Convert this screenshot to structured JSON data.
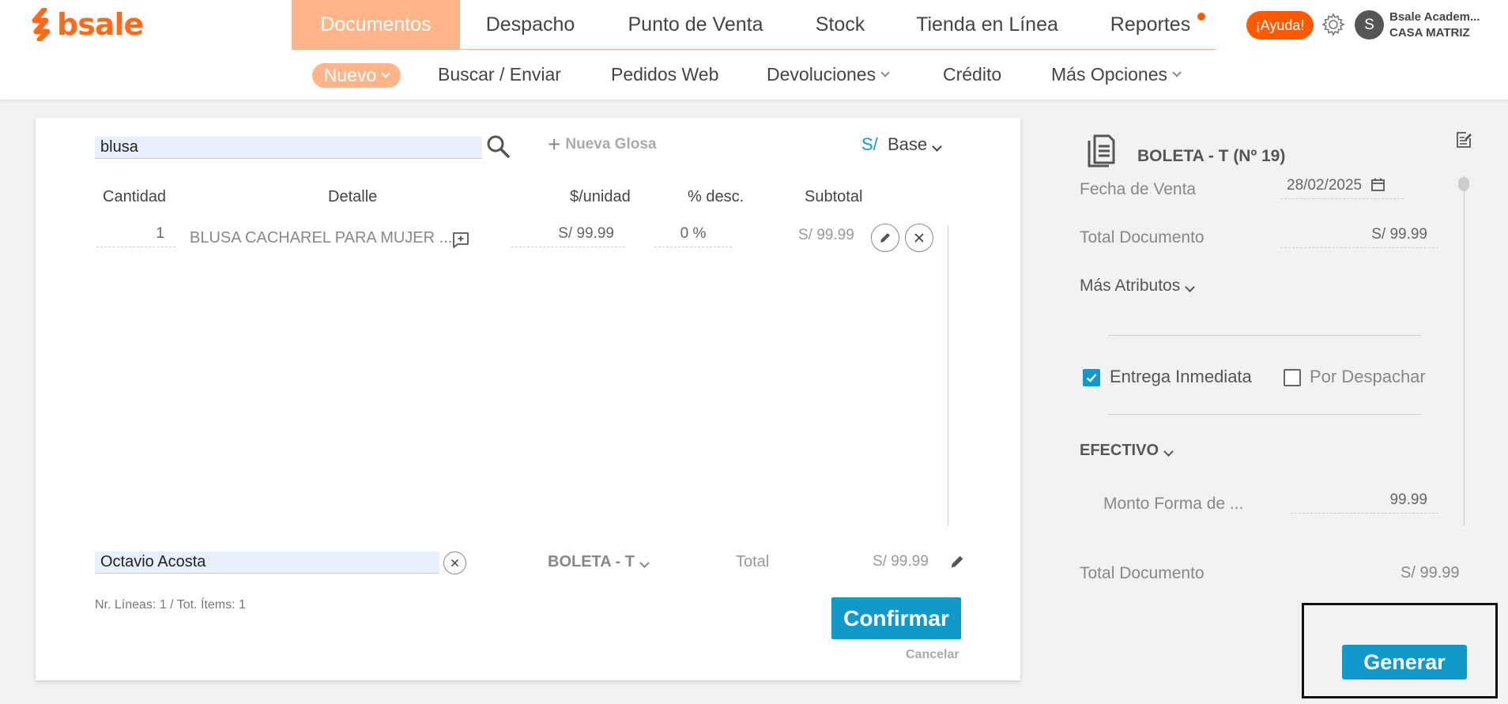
{
  "app": {
    "brand": "bsale"
  },
  "header": {
    "tabs": [
      {
        "label": "Documentos",
        "active": true
      },
      {
        "label": "Despacho"
      },
      {
        "label": "Punto de Venta"
      },
      {
        "label": "Stock"
      },
      {
        "label": "Tienda en Línea"
      },
      {
        "label": "Reportes",
        "has_notification": true
      }
    ],
    "help_label": "¡Ayuda!",
    "user_initial": "S",
    "user_name": "Bsale Academ...",
    "branch": "CASA MATRIZ"
  },
  "subnav": {
    "items": [
      {
        "label": "Nuevo",
        "active": true,
        "dropdown": true
      },
      {
        "label": "Buscar / Enviar"
      },
      {
        "label": "Pedidos Web"
      },
      {
        "label": "Devoluciones",
        "dropdown": true
      },
      {
        "label": "Crédito"
      },
      {
        "label": "Más Opciones",
        "dropdown": true
      }
    ]
  },
  "editor": {
    "search_value": "blusa",
    "new_gloss_label": "Nueva Glosa",
    "currency_symbol": "S/",
    "price_list": "Base",
    "columns": [
      "Cantidad",
      "Detalle",
      "$/unidad",
      "% desc.",
      "Subtotal"
    ],
    "lines": [
      {
        "quantity": "1",
        "detail": "BLUSA CACHAREL PARA MUJER ...",
        "unit_price": "S/ 99.99",
        "discount": "0 %",
        "subtotal": "S/ 99.99"
      }
    ],
    "client_value": "Octavio Acosta",
    "document_type": "BOLETA - T",
    "total_label": "Total",
    "total_value": "S/ 99.99",
    "lines_info": "Nr. Líneas: 1 / Tot. Ítems: 1",
    "confirm_label": "Confirmar",
    "cancel_label": "Cancelar"
  },
  "summary": {
    "document_title": "BOLETA - T (Nº 19)",
    "sale_date_label": "Fecha de Venta",
    "sale_date_value": "28/02/2025",
    "doc_total_label": "Total Documento",
    "doc_total_value": "S/ 99.99",
    "more_attributes_label": "Más Atributos",
    "immediate_delivery_label": "Entrega Inmediata",
    "immediate_delivery_checked": true,
    "to_dispatch_label": "Por Despachar",
    "to_dispatch_checked": false,
    "payment_method": "EFECTIVO",
    "payment_amount_label": "Monto Forma de ...",
    "payment_amount_value": "99.99",
    "footer_total_label": "Total Documento",
    "footer_total_value": "S/ 99.99",
    "generate_label": "Generar"
  },
  "colors": {
    "brand_orange": "#ff6b1a",
    "active_tab": "#ffb58a",
    "accent_blue": "#1199cc",
    "input_fill": "#e8f0fe"
  }
}
